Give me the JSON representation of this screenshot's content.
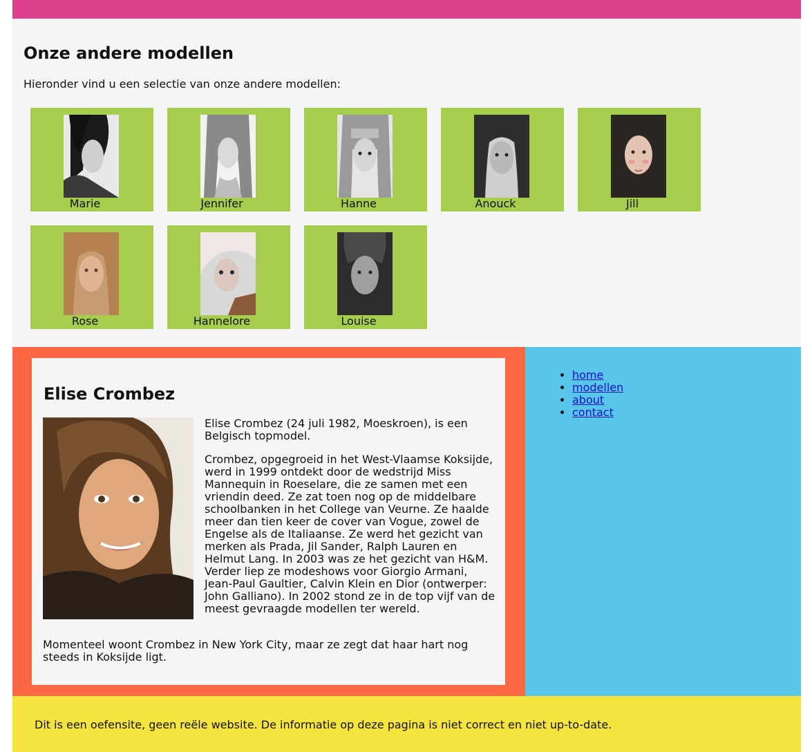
{
  "others_section": {
    "title": "Onze andere modellen",
    "intro": "Hieronder vind u een selectie van onze andere modellen:",
    "models": [
      {
        "name": "Marie"
      },
      {
        "name": "Jennifer"
      },
      {
        "name": "Hanne"
      },
      {
        "name": "Anouck"
      },
      {
        "name": "Jill"
      },
      {
        "name": "Rose"
      },
      {
        "name": "Hannelore"
      },
      {
        "name": "Louise"
      }
    ]
  },
  "article": {
    "title": "Elise Crombez",
    "paragraphs": [
      "Elise Crombez (24 juli 1982, Moeskroen), is een Belgisch topmodel.",
      "Crombez, opgegroeid in het West-Vlaamse Koksijde, werd in 1999 ontdekt door de wedstrijd Miss Mannequin in Roeselare, die ze samen met een vriendin deed. Ze zat toen nog op de middelbare schoolbanken in het College van Veurne. Ze haalde meer dan tien keer de cover van Vogue, zowel de Engelse als de Italiaanse. Ze werd het gezicht van merken als Prada, Jil Sander, Ralph Lauren en Helmut Lang. In 2003 was ze het gezicht van H&M. Verder liep ze modeshows voor Giorgio Armani, Jean-Paul Gaultier, Calvin Klein en Dior (ontwerper: John Galliano). In 2002 stond ze in de top vijf van de meest gevraagde modellen ter wereld.",
      "Momenteel woont Crombez in New York City, maar ze zegt dat haar hart nog steeds in Koksijde ligt."
    ]
  },
  "nav": {
    "items": [
      {
        "label": "home"
      },
      {
        "label": "modellen"
      },
      {
        "label": "about"
      },
      {
        "label": "contact"
      }
    ]
  },
  "footer": {
    "text": "Dit is een oefensite, geen reële website. De informatie op deze pagina is niet correct en niet up-to-date."
  },
  "colors": {
    "topbar": "#dc3f8c",
    "card": "#a6cd4e",
    "main": "#ff6644",
    "sidebar": "#58c6e8",
    "footer": "#f4e43d"
  }
}
